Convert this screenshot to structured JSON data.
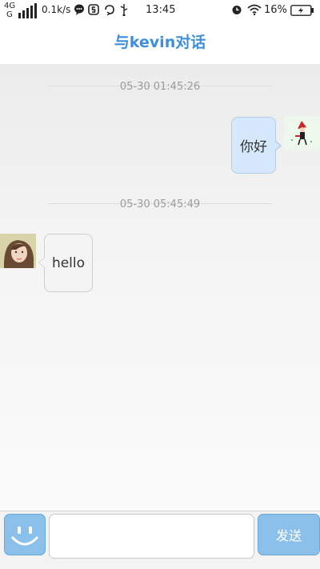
{
  "status_bar": {
    "network_type": "4G",
    "network_sub": "G",
    "speed": "0.1k/s",
    "time": "13:45",
    "battery": "16%",
    "icons": [
      "signal-icon",
      "chat-icon",
      "s-app-icon",
      "sync-icon",
      "usb-icon",
      "alarm-icon",
      "wifi-icon",
      "battery-icon"
    ]
  },
  "header": {
    "title": "与kevin对话"
  },
  "messages": [
    {
      "timestamp": "05-30 01:45:26",
      "sender": "me",
      "text": "你好"
    },
    {
      "timestamp": "05-30 05:45:49",
      "sender": "other",
      "text": "hello"
    }
  ],
  "input_bar": {
    "value": "",
    "placeholder": "",
    "send_label": "发送",
    "emoji_icon": "smiley-icon"
  },
  "colors": {
    "accent": "#3d8fde",
    "button": "#8ac0ea",
    "my_bubble": "#d6e8fb",
    "other_bubble": "#f4f4f4",
    "timestamp": "#9b9b9b"
  }
}
